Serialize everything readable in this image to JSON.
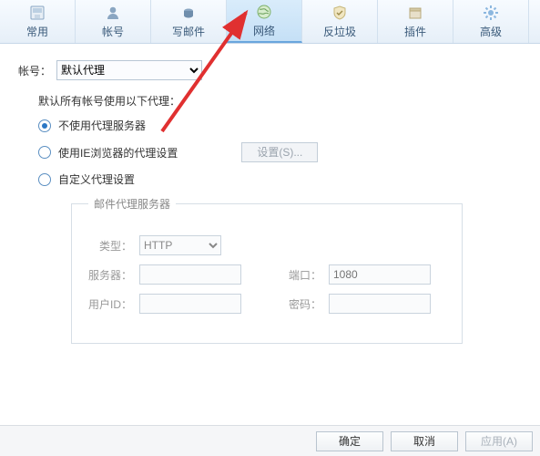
{
  "tabs": [
    {
      "label": "常用"
    },
    {
      "label": "帐号"
    },
    {
      "label": "写邮件"
    },
    {
      "label": "网络"
    },
    {
      "label": "反垃圾"
    },
    {
      "label": "插件"
    },
    {
      "label": "高级"
    }
  ],
  "account": {
    "label": "帐号：",
    "value": "默认代理"
  },
  "proxy_heading": "默认所有帐号使用以下代理：",
  "radios": {
    "none": "不使用代理服务器",
    "ie": "使用IE浏览器的代理设置",
    "custom": "自定义代理设置"
  },
  "settings_btn": "设置(S)...",
  "fieldset": {
    "legend": "邮件代理服务器",
    "type_label": "类型：",
    "type_value": "HTTP",
    "server_label": "服务器：",
    "port_label": "端口：",
    "port_placeholder": "1080",
    "user_label": "用户ID：",
    "pass_label": "密码："
  },
  "footer": {
    "ok": "确定",
    "cancel": "取消",
    "apply": "应用(A)"
  }
}
